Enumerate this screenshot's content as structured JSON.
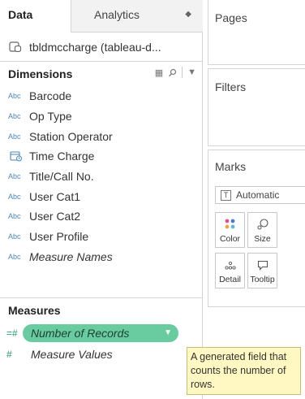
{
  "tabs": {
    "data": "Data",
    "analytics": "Analytics"
  },
  "datasource": {
    "name": "tbldmccharge (tableau-d..."
  },
  "dimensions": {
    "title": "Dimensions",
    "fields": [
      {
        "type": "Abc",
        "label": "Barcode"
      },
      {
        "type": "Abc",
        "label": "Op Type"
      },
      {
        "type": "Abc",
        "label": "Station Operator"
      },
      {
        "type": "calendar-icon",
        "label": "Time Charge"
      },
      {
        "type": "Abc",
        "label": "Title/Call No."
      },
      {
        "type": "Abc",
        "label": "User Cat1"
      },
      {
        "type": "Abc",
        "label": "User Cat2"
      },
      {
        "type": "Abc",
        "label": "User Profile"
      },
      {
        "type": "Abc",
        "label": "Measure Names"
      }
    ]
  },
  "measures": {
    "title": "Measures",
    "fields": [
      {
        "type": "=#",
        "label": "Number of Records"
      },
      {
        "type": "#",
        "label": "Measure Values"
      }
    ]
  },
  "tooltip": {
    "text": "A generated field that counts the number of rows."
  },
  "shelves": {
    "pages": "Pages",
    "filters": "Filters",
    "marks": "Marks"
  },
  "marks": {
    "type": "Automatic",
    "buttons": {
      "color": "Color",
      "size": "Size",
      "detail": "Detail",
      "tooltip": "Tooltip"
    }
  },
  "colors": {
    "measure_pill": "#69cca0",
    "dimension_type": "#4a87b9",
    "measure_type": "#2c9a6c",
    "tooltip_bg": "#fff8c2"
  }
}
